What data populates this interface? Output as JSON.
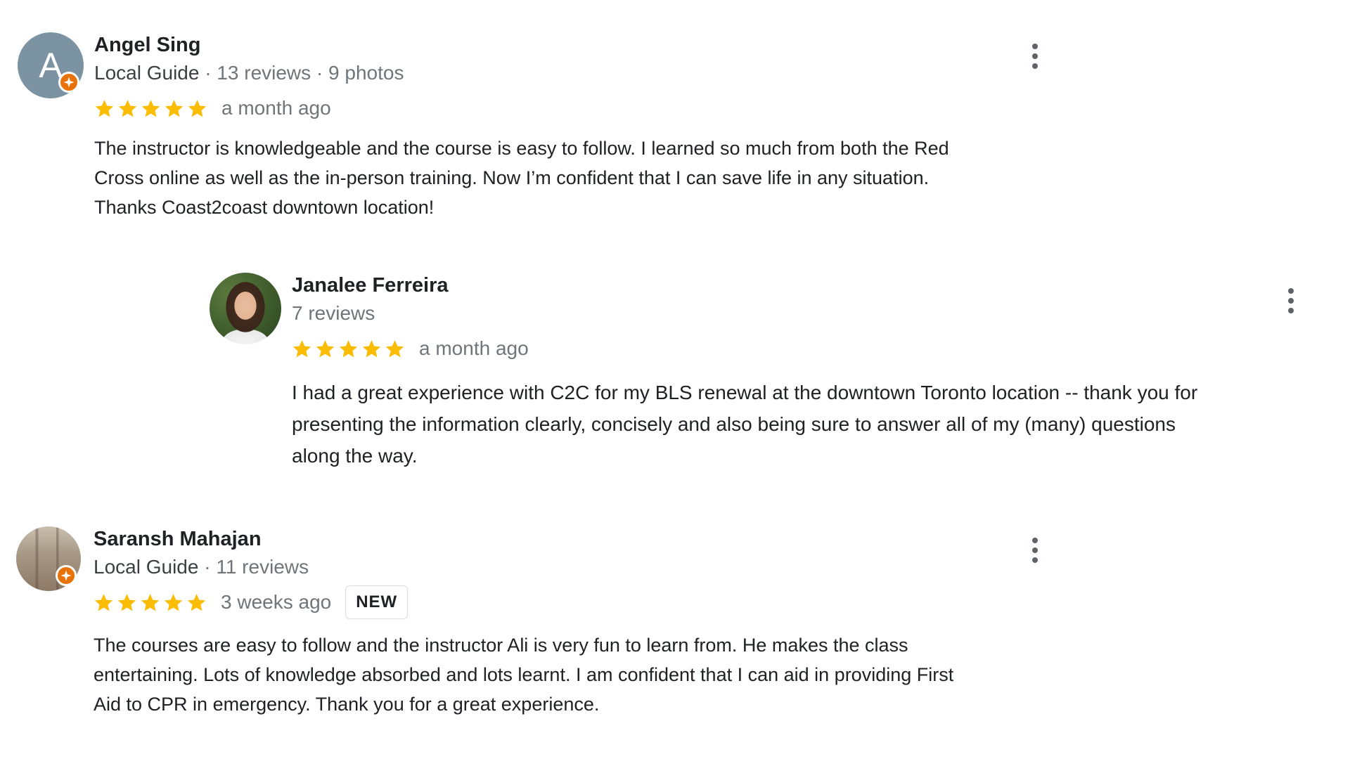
{
  "colors": {
    "star": "#fbbc04",
    "guide_badge": "#e8710a",
    "avatar_letter_bg": "#7c93a3",
    "secondary_text": "#70757a"
  },
  "reviews": [
    {
      "avatar_letter": "A",
      "name": "Angel Sing",
      "local_guide": "Local Guide",
      "stats": " · 13 reviews · 9 photos",
      "rating": 5,
      "time": "a month ago",
      "text": "The instructor is knowledgeable and the course is easy to follow. I learned so much from both the Red\nCross online as well as the in-person training. Now I’m confident that I can save life in any situation.\nThanks Coast2coast downtown location!"
    },
    {
      "name": "Janalee Ferreira",
      "stats": "7 reviews",
      "rating": 5,
      "time": "a month ago",
      "text": "I had a great experience with C2C for my BLS renewal at the downtown Toronto location -- thank you for\npresenting the information clearly, concisely and also being sure to answer all of my (many) questions\nalong the way."
    },
    {
      "name": "Saransh Mahajan",
      "local_guide": "Local Guide",
      "stats": " · 11 reviews",
      "rating": 5,
      "time": "3 weeks ago",
      "badge": "NEW",
      "text": "The courses are easy to follow and the instructor Ali is very fun to learn from. He makes the class\nentertaining. Lots of knowledge absorbed and lots learnt. I am confident that I can aid in providing First\nAid to CPR in emergency. Thank you for a great experience."
    }
  ]
}
